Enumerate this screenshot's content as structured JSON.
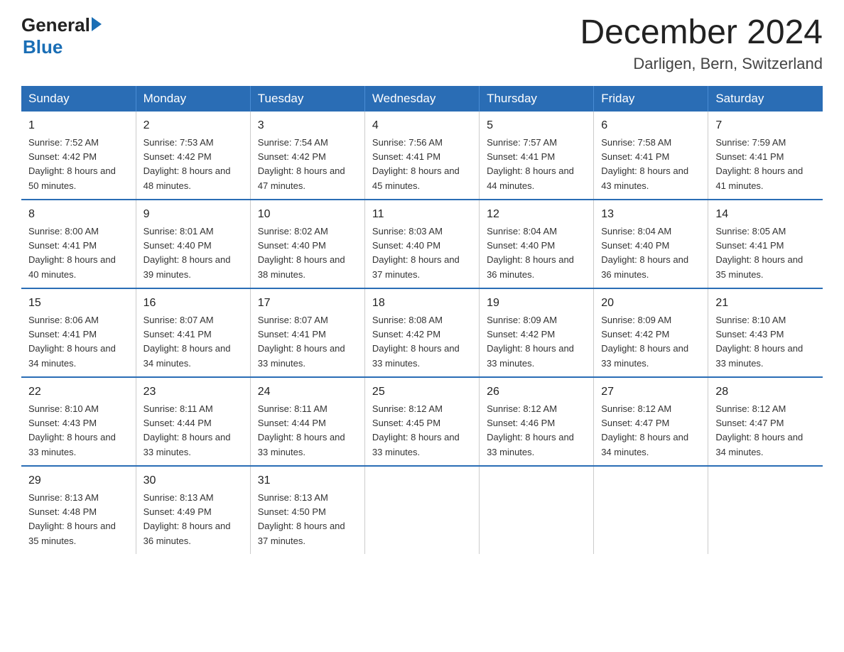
{
  "header": {
    "logo_general": "General",
    "logo_arrow": "▶",
    "logo_blue": "Blue",
    "month_year": "December 2024",
    "location": "Darligen, Bern, Switzerland"
  },
  "days_of_week": [
    "Sunday",
    "Monday",
    "Tuesday",
    "Wednesday",
    "Thursday",
    "Friday",
    "Saturday"
  ],
  "weeks": [
    [
      {
        "day": "1",
        "sunrise": "7:52 AM",
        "sunset": "4:42 PM",
        "daylight": "8 hours and 50 minutes."
      },
      {
        "day": "2",
        "sunrise": "7:53 AM",
        "sunset": "4:42 PM",
        "daylight": "8 hours and 48 minutes."
      },
      {
        "day": "3",
        "sunrise": "7:54 AM",
        "sunset": "4:42 PM",
        "daylight": "8 hours and 47 minutes."
      },
      {
        "day": "4",
        "sunrise": "7:56 AM",
        "sunset": "4:41 PM",
        "daylight": "8 hours and 45 minutes."
      },
      {
        "day": "5",
        "sunrise": "7:57 AM",
        "sunset": "4:41 PM",
        "daylight": "8 hours and 44 minutes."
      },
      {
        "day": "6",
        "sunrise": "7:58 AM",
        "sunset": "4:41 PM",
        "daylight": "8 hours and 43 minutes."
      },
      {
        "day": "7",
        "sunrise": "7:59 AM",
        "sunset": "4:41 PM",
        "daylight": "8 hours and 41 minutes."
      }
    ],
    [
      {
        "day": "8",
        "sunrise": "8:00 AM",
        "sunset": "4:41 PM",
        "daylight": "8 hours and 40 minutes."
      },
      {
        "day": "9",
        "sunrise": "8:01 AM",
        "sunset": "4:40 PM",
        "daylight": "8 hours and 39 minutes."
      },
      {
        "day": "10",
        "sunrise": "8:02 AM",
        "sunset": "4:40 PM",
        "daylight": "8 hours and 38 minutes."
      },
      {
        "day": "11",
        "sunrise": "8:03 AM",
        "sunset": "4:40 PM",
        "daylight": "8 hours and 37 minutes."
      },
      {
        "day": "12",
        "sunrise": "8:04 AM",
        "sunset": "4:40 PM",
        "daylight": "8 hours and 36 minutes."
      },
      {
        "day": "13",
        "sunrise": "8:04 AM",
        "sunset": "4:40 PM",
        "daylight": "8 hours and 36 minutes."
      },
      {
        "day": "14",
        "sunrise": "8:05 AM",
        "sunset": "4:41 PM",
        "daylight": "8 hours and 35 minutes."
      }
    ],
    [
      {
        "day": "15",
        "sunrise": "8:06 AM",
        "sunset": "4:41 PM",
        "daylight": "8 hours and 34 minutes."
      },
      {
        "day": "16",
        "sunrise": "8:07 AM",
        "sunset": "4:41 PM",
        "daylight": "8 hours and 34 minutes."
      },
      {
        "day": "17",
        "sunrise": "8:07 AM",
        "sunset": "4:41 PM",
        "daylight": "8 hours and 33 minutes."
      },
      {
        "day": "18",
        "sunrise": "8:08 AM",
        "sunset": "4:42 PM",
        "daylight": "8 hours and 33 minutes."
      },
      {
        "day": "19",
        "sunrise": "8:09 AM",
        "sunset": "4:42 PM",
        "daylight": "8 hours and 33 minutes."
      },
      {
        "day": "20",
        "sunrise": "8:09 AM",
        "sunset": "4:42 PM",
        "daylight": "8 hours and 33 minutes."
      },
      {
        "day": "21",
        "sunrise": "8:10 AM",
        "sunset": "4:43 PM",
        "daylight": "8 hours and 33 minutes."
      }
    ],
    [
      {
        "day": "22",
        "sunrise": "8:10 AM",
        "sunset": "4:43 PM",
        "daylight": "8 hours and 33 minutes."
      },
      {
        "day": "23",
        "sunrise": "8:11 AM",
        "sunset": "4:44 PM",
        "daylight": "8 hours and 33 minutes."
      },
      {
        "day": "24",
        "sunrise": "8:11 AM",
        "sunset": "4:44 PM",
        "daylight": "8 hours and 33 minutes."
      },
      {
        "day": "25",
        "sunrise": "8:12 AM",
        "sunset": "4:45 PM",
        "daylight": "8 hours and 33 minutes."
      },
      {
        "day": "26",
        "sunrise": "8:12 AM",
        "sunset": "4:46 PM",
        "daylight": "8 hours and 33 minutes."
      },
      {
        "day": "27",
        "sunrise": "8:12 AM",
        "sunset": "4:47 PM",
        "daylight": "8 hours and 34 minutes."
      },
      {
        "day": "28",
        "sunrise": "8:12 AM",
        "sunset": "4:47 PM",
        "daylight": "8 hours and 34 minutes."
      }
    ],
    [
      {
        "day": "29",
        "sunrise": "8:13 AM",
        "sunset": "4:48 PM",
        "daylight": "8 hours and 35 minutes."
      },
      {
        "day": "30",
        "sunrise": "8:13 AM",
        "sunset": "4:49 PM",
        "daylight": "8 hours and 36 minutes."
      },
      {
        "day": "31",
        "sunrise": "8:13 AM",
        "sunset": "4:50 PM",
        "daylight": "8 hours and 37 minutes."
      },
      null,
      null,
      null,
      null
    ]
  ]
}
